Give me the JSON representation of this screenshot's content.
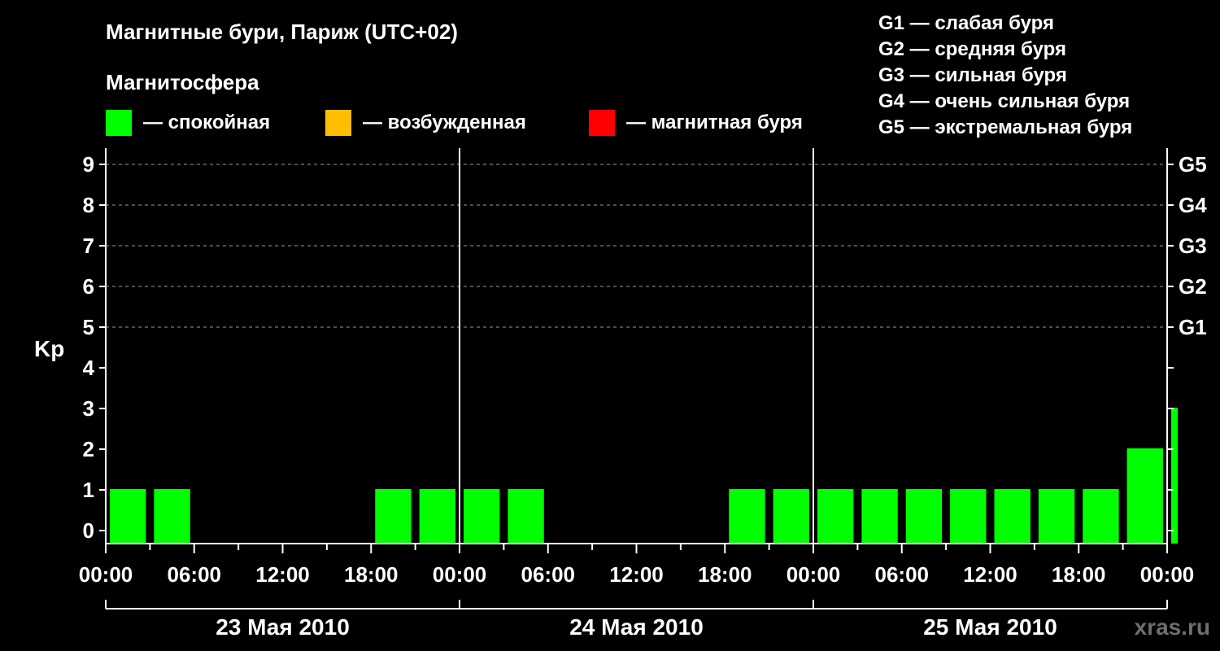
{
  "header": {
    "title": "Магнитные бури, Париж (UTC+02)",
    "subtitle": "Магнитосфера"
  },
  "legend": {
    "states": [
      {
        "label": "— спокойная",
        "color": "#00ff00"
      },
      {
        "label": "— возбужденная",
        "color": "#ffbf00"
      },
      {
        "label": "— магнитная буря",
        "color": "#ff0000"
      }
    ],
    "storm_levels": [
      "G1 — слабая буря",
      "G2 — средняя буря",
      "G3 — сильная буря",
      "G4 — очень сильная буря",
      "G5 — экстремальная буря"
    ]
  },
  "chart_data": {
    "type": "bar",
    "ylabel": "Kp",
    "ylim": [
      0,
      9
    ],
    "yticks": [
      "0",
      "1",
      "2",
      "3",
      "4",
      "5",
      "6",
      "7",
      "8",
      "9"
    ],
    "right_ticks": [
      {
        "value": 5,
        "label": "G1"
      },
      {
        "value": 6,
        "label": "G2"
      },
      {
        "value": 7,
        "label": "G3"
      },
      {
        "value": 8,
        "label": "G4"
      },
      {
        "value": 9,
        "label": "G5"
      }
    ],
    "grid": "dashed horizontal at Kp 5–9",
    "xticks": [
      "00:00",
      "06:00",
      "12:00",
      "18:00",
      "00:00",
      "06:00",
      "12:00",
      "18:00",
      "00:00",
      "06:00",
      "12:00",
      "18:00",
      "00:00"
    ],
    "days": [
      "23 Мая 2010",
      "24 Мая 2010",
      "25 Мая 2010"
    ],
    "interval_hours": 3,
    "values": [
      1,
      1,
      0,
      0,
      0,
      0,
      1,
      1,
      1,
      1,
      0,
      0,
      0,
      0,
      1,
      1,
      1,
      1,
      1,
      1,
      1,
      1,
      1,
      2,
      3
    ],
    "partial_last_interval_hours": 1
  },
  "watermark": "xras.ru"
}
